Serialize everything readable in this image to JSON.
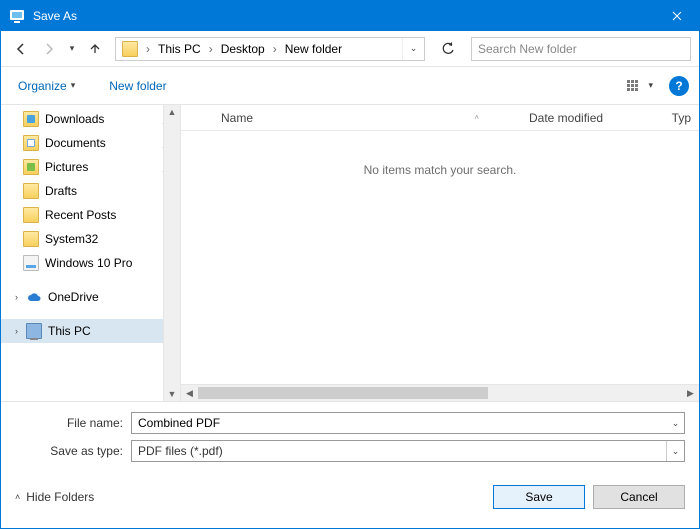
{
  "title": "Save As",
  "nav": {
    "recent_dd": "▾",
    "crumbs": [
      "This PC",
      "Desktop",
      "New folder"
    ]
  },
  "search": {
    "placeholder": "Search New folder"
  },
  "toolbar": {
    "organize": "Organize",
    "newfolder": "New folder"
  },
  "tree": {
    "items": [
      {
        "label": "Downloads",
        "pin": true,
        "ic": "folder blue"
      },
      {
        "label": "Documents",
        "pin": true,
        "ic": "folder doc"
      },
      {
        "label": "Pictures",
        "pin": true,
        "ic": "folder green"
      },
      {
        "label": "Drafts",
        "pin": false,
        "ic": "folder"
      },
      {
        "label": "Recent Posts",
        "pin": false,
        "ic": "folder"
      },
      {
        "label": "System32",
        "pin": false,
        "ic": "folder"
      },
      {
        "label": "Windows 10 Pro",
        "pin": false,
        "ic": "drive"
      }
    ],
    "onedrive": "OneDrive",
    "thispc": "This PC"
  },
  "columns": {
    "name": "Name",
    "date": "Date modified",
    "type": "Typ"
  },
  "empty": "No items match your search.",
  "fields": {
    "fname_label": "File name:",
    "fname_value": "Combined PDF",
    "type_label": "Save as type:",
    "type_value": "PDF files (*.pdf)"
  },
  "footer": {
    "hide": "Hide Folders",
    "save": "Save",
    "cancel": "Cancel"
  }
}
